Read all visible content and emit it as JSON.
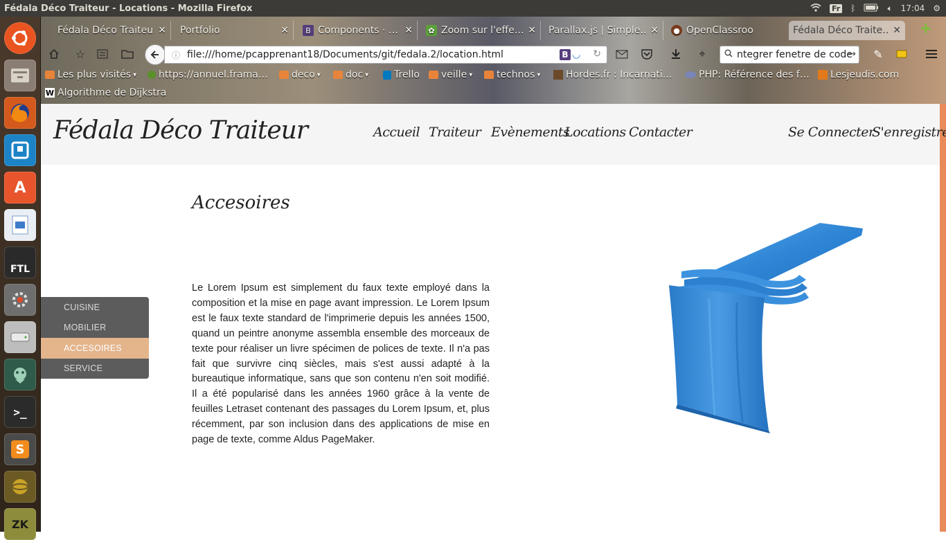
{
  "os": {
    "window_title": "Fédala Déco Traiteur - Locations - Mozilla Firefox",
    "keyboard_layout": "Fr",
    "clock": "17:04"
  },
  "browser": {
    "tabs": [
      {
        "label": "Fédala Déco Traiteur",
        "close": "✕",
        "icon": "web-icon"
      },
      {
        "label": "Portfolio",
        "close": "✕",
        "icon": "none"
      },
      {
        "label": "Components · …",
        "close": "✕",
        "icon": "bootstrap-icon"
      },
      {
        "label": "Zoom sur l'effe…",
        "close": "✕",
        "icon": "leaf-icon"
      },
      {
        "label": "Parallax.js | Simple…",
        "close": "✕",
        "icon": "none"
      },
      {
        "label": "OpenClassroo",
        "close": "",
        "icon": "openclassrooms-icon"
      },
      {
        "label": "Fédala Déco Traite…",
        "close": "✕",
        "icon": "none",
        "active": true
      }
    ],
    "new_tab": "+",
    "url": "file:///home/pcapprenant18/Documents/git/fedala.2/location.html",
    "search_text": "ntegrer fenetre de code",
    "bookmarks_row1": [
      {
        "label": "Les plus visités",
        "icon": "star-icon",
        "dropdown": true
      },
      {
        "label": "https://annuel.frama…",
        "icon": "framasoft-icon"
      },
      {
        "label": "deco",
        "icon": "folder-icon",
        "dropdown": true
      },
      {
        "label": "doc",
        "icon": "folder-icon",
        "dropdown": true
      },
      {
        "label": "Trello",
        "icon": "trello-icon"
      },
      {
        "label": "veille",
        "icon": "folder-icon",
        "dropdown": true
      },
      {
        "label": "technos",
        "icon": "folder-icon",
        "dropdown": true
      },
      {
        "label": "Hordes.fr : Incarnati…",
        "icon": "hordes-icon"
      },
      {
        "label": "PHP: Référence des f…",
        "icon": "php-icon"
      },
      {
        "label": "Lesjeudis.com",
        "icon": "lesjeudis-icon"
      }
    ],
    "bookmarks_row2": [
      {
        "label": "Algorithme de Dijkstra",
        "icon": "wikipedia-icon"
      }
    ]
  },
  "site": {
    "brand": "Fédala Déco Traiteur",
    "nav": [
      "Accueil",
      "Traiteur",
      "Evènements",
      "Locations",
      "Contacter"
    ],
    "auth": [
      "Se Connecter",
      "S'enregistrer"
    ],
    "section_title": "Accesoires",
    "sidebar": [
      {
        "label": "CUISINE",
        "active": false
      },
      {
        "label": "MOBILIER",
        "active": false
      },
      {
        "label": "ACCESOIRES",
        "active": true
      },
      {
        "label": "SERVICE",
        "active": false
      }
    ],
    "body_text": "Le Lorem Ipsum est simplement du faux texte employé dans la composition et la mise en page avant impression. Le Lorem Ipsum est le faux texte standard de l'imprimerie depuis les années 1500, quand un peintre anonyme assembla ensemble des morceaux de texte pour réaliser un livre spécimen de polices de texte. Il n'a pas fait que survivre cinq siècles, mais s'est aussi adapté à la bureautique informatique, sans que son contenu n'en soit modifié. Il a été popularisé dans les années 1960 grâce à la vente de feuilles Letraset contenant des passages du Lorem Ipsum, et, plus récemment, par son inclusion dans des applications de mise en page de texte, comme Aldus PageMaker.",
    "colors": {
      "header_bg": "#f5f5f5",
      "sidebar_bg": "#5c5c5c",
      "sidebar_active": "#e4b48b",
      "product_blue": "#2f86d6",
      "scroll_stripe": "#e88a5a"
    }
  }
}
